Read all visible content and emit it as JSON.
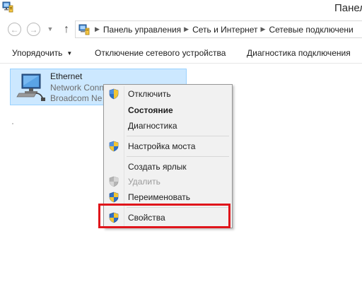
{
  "window": {
    "title": "Панел"
  },
  "address": {
    "crumbs": [
      "Панель управления",
      "Сеть и Интернет",
      "Сетевые подключени"
    ]
  },
  "commands": {
    "organize": "Упорядочить",
    "disable": "Отключение сетевого устройства",
    "diagnose": "Диагностика подключения"
  },
  "connection": {
    "name": "Ethernet",
    "status": "Network Conn",
    "adapter": "Broadcom Ne"
  },
  "context_menu": {
    "items": [
      {
        "label": "Отключить",
        "icon": "uac-shield-icon"
      },
      {
        "label": "Состояние",
        "bold": true
      },
      {
        "label": "Диагностика"
      },
      {
        "label": "Настройка моста",
        "icon": "uac-shield-icon"
      },
      {
        "label": "Создать ярлык"
      },
      {
        "label": "Удалить",
        "icon": "uac-shield-icon",
        "disabled": true
      },
      {
        "label": "Переименовать",
        "icon": "uac-shield-icon"
      },
      {
        "label": "Свойства",
        "icon": "uac-shield-icon",
        "highlighted": true
      }
    ]
  },
  "colors": {
    "selection_bg": "#cce8ff",
    "selection_border": "#99d1ff",
    "highlight": "#e0151b",
    "menu_bg": "#f1f1f1"
  }
}
